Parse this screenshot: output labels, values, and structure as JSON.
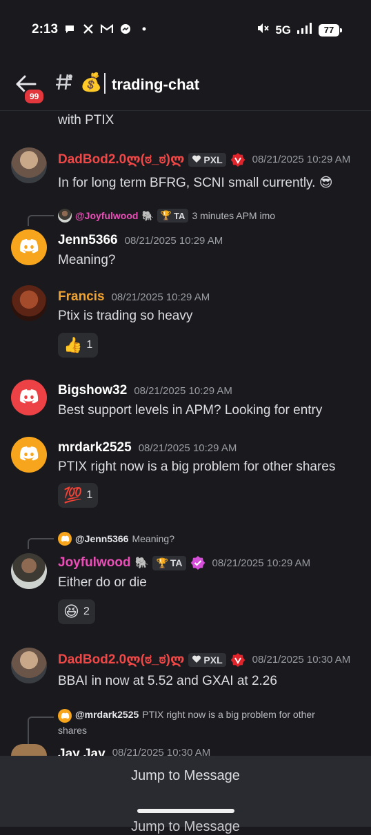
{
  "status_bar": {
    "time": "2:13",
    "network": "5G",
    "battery": "77"
  },
  "header": {
    "badge": "99",
    "emoji": "💰",
    "channel": "trading-chat"
  },
  "messages": {
    "cont_text": "with PTIX",
    "m1": {
      "name": "DadBod2.0ლ(ಠ_ಠ)ლ",
      "tag": "PXL",
      "time": "08/21/2025 10:29 AM",
      "text": "In for long term BFRG, SCNI small currently.",
      "emoji": "😎"
    },
    "r2": {
      "name": "@Joyfulwood",
      "emoji": "🐘",
      "tag": "TA",
      "text": "3 minutes APM imo"
    },
    "m2": {
      "name": "Jenn5366",
      "time": "08/21/2025 10:29 AM",
      "text": "Meaning?"
    },
    "m3": {
      "name": "Francis",
      "time": "08/21/2025 10:29 AM",
      "text": "Ptix is trading so heavy",
      "reaction_emoji": "👍",
      "reaction_count": "1"
    },
    "m4": {
      "name": "Bigshow32",
      "time": "08/21/2025 10:29 AM",
      "text": "Best support levels in APM?  Looking for entry"
    },
    "m5": {
      "name": "mrdark2525",
      "time": "08/21/2025 10:29 AM",
      "text": "PTIX right now is a big problem for other shares",
      "reaction_emoji": "💯",
      "reaction_count": "1"
    },
    "r6": {
      "name": "@Jenn5366",
      "text": "Meaning?"
    },
    "m6": {
      "name": "Joyfulwood",
      "emoji": "🐘",
      "tag": "TA",
      "time": "08/21/2025 10:29 AM",
      "text": "Either do or die",
      "reaction_emoji": "😆",
      "reaction_count": "2"
    },
    "m7": {
      "name": "DadBod2.0ლ(ಠ_ಠ)ლ",
      "tag": "PXL",
      "time": "08/21/2025 10:30 AM",
      "text": "BBAI in now at 5.52 and GXAI at 2.26"
    },
    "r8": {
      "name": "@mrdark2525",
      "text_line1": "PTIX right now is a big problem for other",
      "text_line2": "shares"
    },
    "m8": {
      "name": "Jay Jay",
      "time": "08/21/2025 10:30 AM"
    }
  },
  "bottom": {
    "jump_label": "Jump to Message"
  },
  "colors": {
    "red_name": "#f04747",
    "orange_name": "#f0a232",
    "pink_name": "#e94fb6",
    "discord_orange": "#f7a51c",
    "discord_red": "#ed4245"
  }
}
